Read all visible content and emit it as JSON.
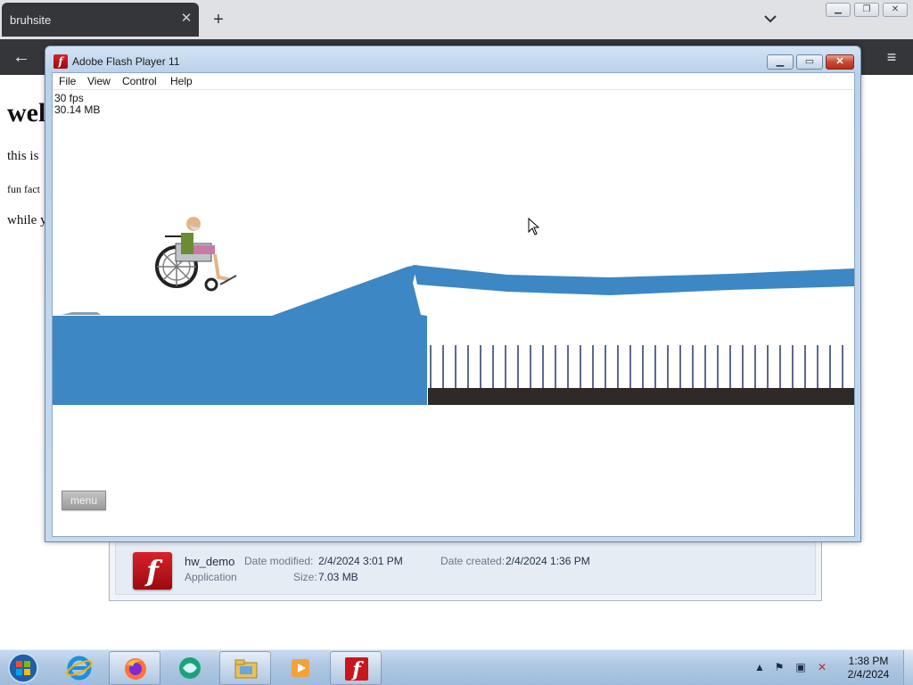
{
  "browser": {
    "tab_title": "bruhsite",
    "tab_close": "✕",
    "new_tab": "+",
    "back": "←",
    "menu": "≡",
    "window_controls": {
      "minimize": "▁",
      "restore": "❐",
      "close": "✕"
    }
  },
  "page": {
    "heading": "wel",
    "lines": [
      "this is",
      "fun fact",
      "while y"
    ]
  },
  "details_pane": {
    "name": "hw_demo",
    "type": "Application",
    "date_modified_label": "Date modified:",
    "date_modified": "2/4/2024 3:01 PM",
    "size_label": "Size:",
    "size": "7.03 MB",
    "date_created_label": "Date created:",
    "date_created": "2/4/2024 1:36 PM",
    "icon_glyph": "f"
  },
  "flash_window": {
    "title": "Adobe Flash Player 11",
    "icon_glyph": "f",
    "controls": {
      "minimize": "▁",
      "maximize": "▭",
      "close": "✕"
    },
    "menu": [
      "File",
      "View",
      "Control",
      "Help"
    ],
    "stats": {
      "fps": "30 fps",
      "memory": "30.14 MB"
    },
    "menu_button": "menu",
    "colors": {
      "ground": "#3c87c4",
      "spike_base": "#2f2a28",
      "spike": "#5d6a8f"
    }
  },
  "taskbar": {
    "items": [
      "start-orb",
      "internet-explorer-icon",
      "firefox-icon",
      "app-icon",
      "file-explorer-icon",
      "media-player-icon",
      "flash-player-icon"
    ],
    "clock_time": "1:38 PM",
    "clock_date": "2/4/2024"
  }
}
